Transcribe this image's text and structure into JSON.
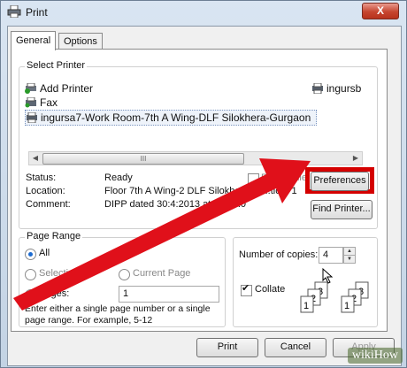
{
  "window": {
    "title": "Print",
    "close_label": "X"
  },
  "tabs": [
    {
      "label": "General"
    },
    {
      "label": "Options"
    }
  ],
  "select_printer": {
    "title": "Select Printer",
    "items": [
      {
        "label": "Add Printer",
        "icon": "add-printer-icon"
      },
      {
        "label": "Fax",
        "icon": "fax-icon"
      },
      {
        "label": "ingursa7-Work Room-7th A Wing-DLF Silokhera-Gurgaon",
        "icon": "printer-icon"
      }
    ],
    "right_item": "ingursb",
    "status_label": "Status:",
    "status_value": "Ready",
    "location_label": "Location:",
    "location_value": "Floor 7th A Wing-2 DLF Silokhera In ...tion, 1",
    "comment_label": "Comment:",
    "comment_value": "DIPP dated 30:4:2013 at 19:21:0",
    "print_to_file": "Print to file",
    "preferences_button": "Preferences",
    "find_printer_button": "Find Printer..."
  },
  "page_range": {
    "title": "Page Range",
    "all": "All",
    "selection": "Selection",
    "current_page": "Current Page",
    "pages": "Pages:",
    "pages_value": "1",
    "help_text": "Enter either a single page number or a single page range.  For example, 5-12"
  },
  "copies": {
    "label": "Number of copies:",
    "value": "4",
    "collate": "Collate"
  },
  "footer": {
    "print": "Print",
    "cancel": "Cancel",
    "apply": "Apply"
  },
  "watermark": "wikiHow",
  "colors": {
    "annotation_red": "#e0101a",
    "highlight_box": "#d40000"
  }
}
